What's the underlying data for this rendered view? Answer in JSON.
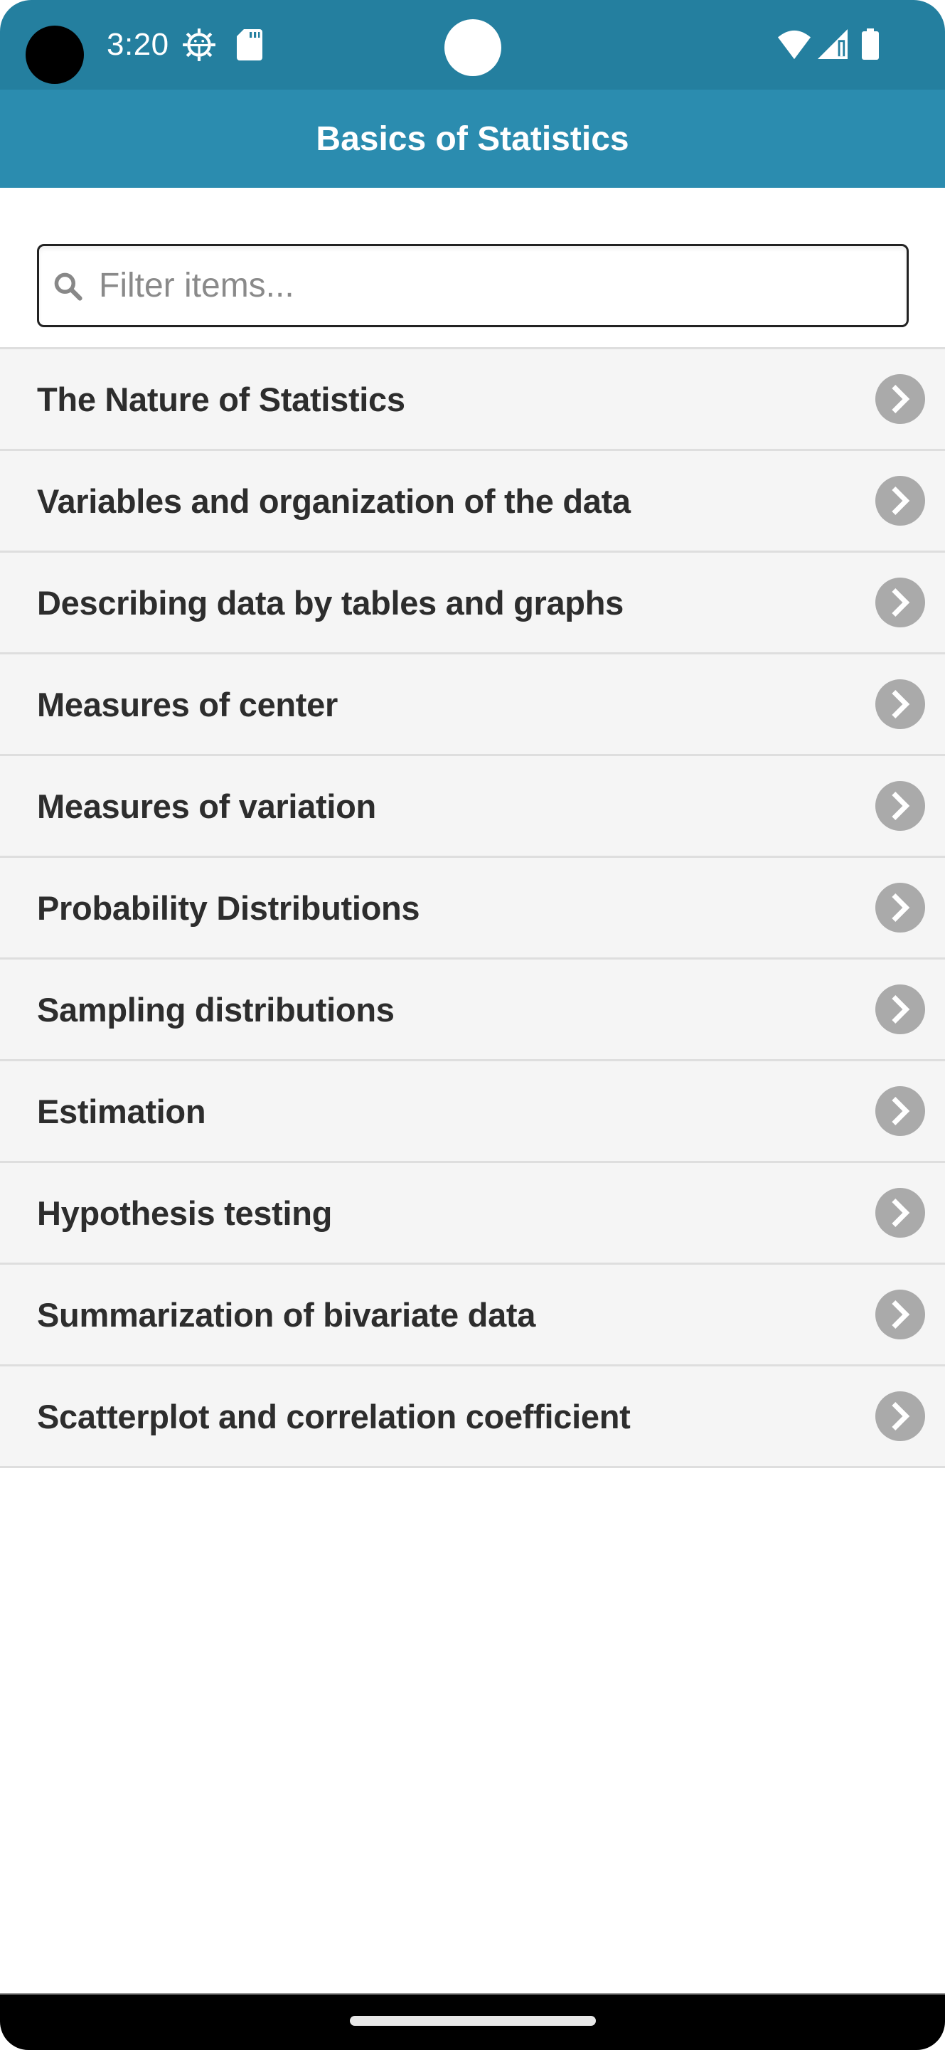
{
  "status_bar": {
    "time": "3:20",
    "left_icons": [
      "camera-cutout",
      "gear-icon",
      "sd-card-icon"
    ],
    "right_icons": [
      "wifi-icon",
      "cell-signal-icon",
      "battery-icon"
    ]
  },
  "app_bar": {
    "title": "Basics of Statistics",
    "color": "#2b8caf"
  },
  "search": {
    "placeholder": "Filter items...",
    "value": "",
    "icon": "search-icon"
  },
  "list": {
    "items": [
      {
        "label": "The Nature of Statistics"
      },
      {
        "label": "Variables and organization of the data"
      },
      {
        "label": "Describing data by tables and graphs"
      },
      {
        "label": "Measures of center"
      },
      {
        "label": "Measures of variation"
      },
      {
        "label": "Probability Distributions"
      },
      {
        "label": "Sampling distributions"
      },
      {
        "label": "Estimation"
      },
      {
        "label": "Hypothesis testing"
      },
      {
        "label": "Summarization of bivariate data"
      },
      {
        "label": "Scatterplot and correlation coefficient"
      }
    ],
    "trailing_icon": "chevron-right-circle-icon"
  }
}
